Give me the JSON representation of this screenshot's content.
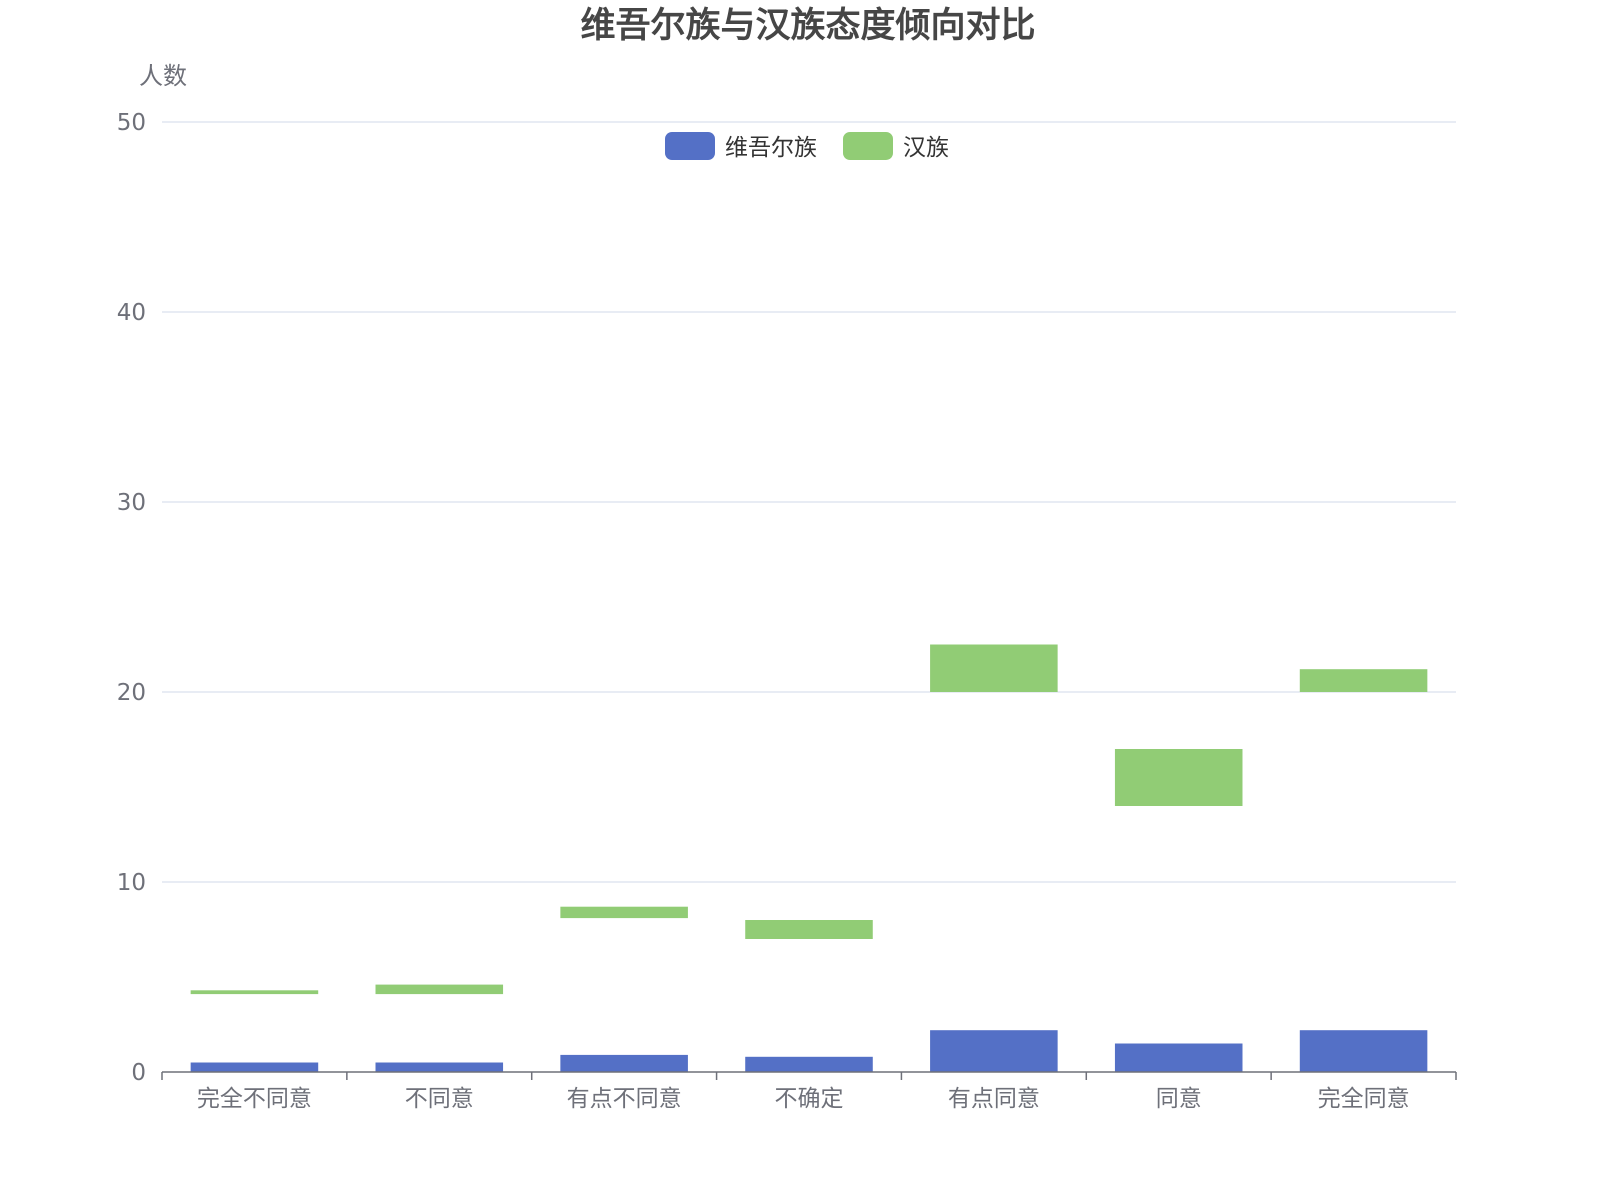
{
  "chart_data": {
    "type": "bar",
    "title": "维吾尔族与汉族态度倾向对比",
    "ylabel": "人数",
    "xlabel": "",
    "ylim": [
      0,
      50
    ],
    "yticks": [
      0,
      10,
      20,
      30,
      40,
      50
    ],
    "grid": true,
    "legend_position": "top-center",
    "categories": [
      "完全不同意",
      "不同意",
      "有点不同意",
      "不确定",
      "有点同意",
      "同意",
      "完全同意"
    ],
    "series": [
      {
        "name": "维吾尔族",
        "color": "#5470c6",
        "values": [
          0.5,
          0.5,
          0.9,
          0.8,
          2.2,
          1.5,
          2.2
        ]
      },
      {
        "name": "汉族",
        "color": "#91cc75",
        "ranges": [
          [
            4.1,
            4.3
          ],
          [
            4.1,
            4.6
          ],
          [
            8.1,
            8.7
          ],
          [
            7.0,
            8.0
          ],
          [
            20.0,
            22.5
          ],
          [
            14.0,
            17.0
          ],
          [
            20.0,
            21.2
          ]
        ]
      }
    ]
  }
}
